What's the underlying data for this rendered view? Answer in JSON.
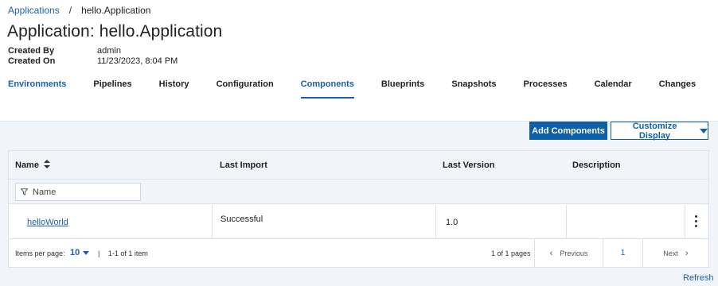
{
  "breadcrumb": {
    "root": "Applications",
    "separator": "/",
    "current": "hello.Application"
  },
  "page_title": "Application: hello.Application",
  "meta": {
    "created_by_label": "Created By",
    "created_by": "admin",
    "created_on_label": "Created On",
    "created_on": "11/23/2023, 8:04 PM"
  },
  "tabs": [
    {
      "label": "Environments"
    },
    {
      "label": "Pipelines"
    },
    {
      "label": "History"
    },
    {
      "label": "Configuration"
    },
    {
      "label": "Components"
    },
    {
      "label": "Blueprints"
    },
    {
      "label": "Snapshots"
    },
    {
      "label": "Processes"
    },
    {
      "label": "Calendar"
    },
    {
      "label": "Changes"
    }
  ],
  "toolbar": {
    "add_label": "Add Components",
    "customize_label": "Customize Display"
  },
  "table": {
    "columns": [
      "Name",
      "Last Import",
      "Last Version",
      "Description"
    ],
    "filter_placeholder": "Name",
    "rows": [
      {
        "name": "helloWorld",
        "last_import": "Successful",
        "last_version": "1.0",
        "description": ""
      }
    ]
  },
  "pagination": {
    "items_per_page_label": "Items per page:",
    "items_per_page": "10",
    "separator": "|",
    "range": "1-1 of 1 item",
    "pages": "1 of 1 pages",
    "previous": "Previous",
    "current_page": "1",
    "next": "Next"
  },
  "refresh_label": "Refresh",
  "colors": {
    "accent": "#0f5fa8",
    "link": "#1a5fb4",
    "panel_bg": "#f1f4f8"
  }
}
